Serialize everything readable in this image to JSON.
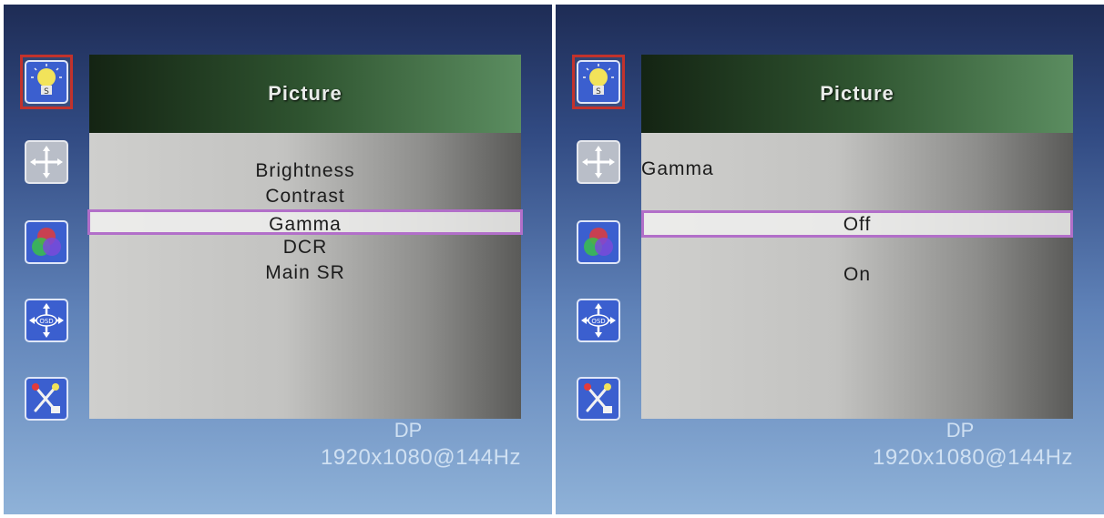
{
  "left_screen": {
    "title": "Picture",
    "menu_items": [
      "Brightness",
      "Contrast",
      "Gamma",
      "DCR",
      "Main SR"
    ],
    "selected_index": 2,
    "source": "DP",
    "resolution": "1920x1080@144Hz"
  },
  "right_screen": {
    "title": "Picture",
    "submenu_title": "Gamma",
    "options": [
      "Off",
      "On"
    ],
    "selected_index": 0,
    "source": "DP",
    "resolution": "1920x1080@144Hz"
  },
  "sidebar_icons": [
    "lightbulb-icon",
    "position-arrows-icon",
    "color-rgb-icon",
    "osd-settings-icon",
    "tools-reset-icon"
  ],
  "colors": {
    "selection_border": "#c2322c",
    "highlight_border": "#b26fc9",
    "title_bar_dark": "#142413",
    "title_bar_light": "#5b8d60"
  }
}
